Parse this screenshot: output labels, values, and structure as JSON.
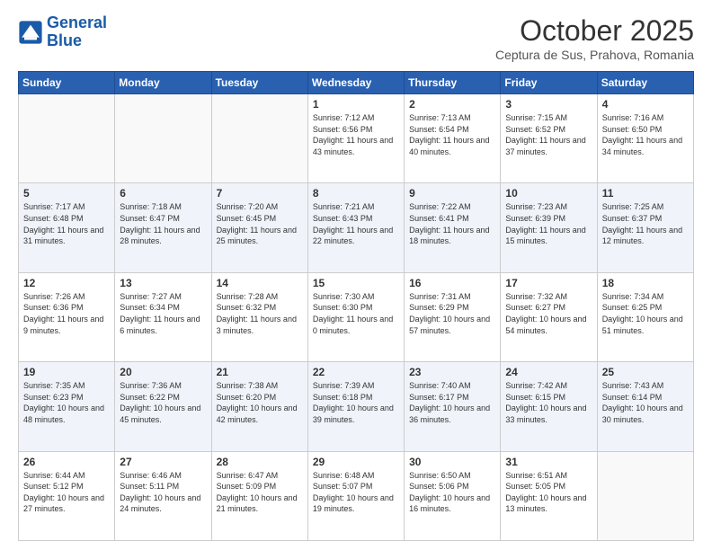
{
  "header": {
    "logo_line1": "General",
    "logo_line2": "Blue",
    "month": "October 2025",
    "location": "Ceptura de Sus, Prahova, Romania"
  },
  "weekdays": [
    "Sunday",
    "Monday",
    "Tuesday",
    "Wednesday",
    "Thursday",
    "Friday",
    "Saturday"
  ],
  "weeks": [
    [
      {
        "day": "",
        "info": ""
      },
      {
        "day": "",
        "info": ""
      },
      {
        "day": "",
        "info": ""
      },
      {
        "day": "1",
        "info": "Sunrise: 7:12 AM\nSunset: 6:56 PM\nDaylight: 11 hours and 43 minutes."
      },
      {
        "day": "2",
        "info": "Sunrise: 7:13 AM\nSunset: 6:54 PM\nDaylight: 11 hours and 40 minutes."
      },
      {
        "day": "3",
        "info": "Sunrise: 7:15 AM\nSunset: 6:52 PM\nDaylight: 11 hours and 37 minutes."
      },
      {
        "day": "4",
        "info": "Sunrise: 7:16 AM\nSunset: 6:50 PM\nDaylight: 11 hours and 34 minutes."
      }
    ],
    [
      {
        "day": "5",
        "info": "Sunrise: 7:17 AM\nSunset: 6:48 PM\nDaylight: 11 hours and 31 minutes."
      },
      {
        "day": "6",
        "info": "Sunrise: 7:18 AM\nSunset: 6:47 PM\nDaylight: 11 hours and 28 minutes."
      },
      {
        "day": "7",
        "info": "Sunrise: 7:20 AM\nSunset: 6:45 PM\nDaylight: 11 hours and 25 minutes."
      },
      {
        "day": "8",
        "info": "Sunrise: 7:21 AM\nSunset: 6:43 PM\nDaylight: 11 hours and 22 minutes."
      },
      {
        "day": "9",
        "info": "Sunrise: 7:22 AM\nSunset: 6:41 PM\nDaylight: 11 hours and 18 minutes."
      },
      {
        "day": "10",
        "info": "Sunrise: 7:23 AM\nSunset: 6:39 PM\nDaylight: 11 hours and 15 minutes."
      },
      {
        "day": "11",
        "info": "Sunrise: 7:25 AM\nSunset: 6:37 PM\nDaylight: 11 hours and 12 minutes."
      }
    ],
    [
      {
        "day": "12",
        "info": "Sunrise: 7:26 AM\nSunset: 6:36 PM\nDaylight: 11 hours and 9 minutes."
      },
      {
        "day": "13",
        "info": "Sunrise: 7:27 AM\nSunset: 6:34 PM\nDaylight: 11 hours and 6 minutes."
      },
      {
        "day": "14",
        "info": "Sunrise: 7:28 AM\nSunset: 6:32 PM\nDaylight: 11 hours and 3 minutes."
      },
      {
        "day": "15",
        "info": "Sunrise: 7:30 AM\nSunset: 6:30 PM\nDaylight: 11 hours and 0 minutes."
      },
      {
        "day": "16",
        "info": "Sunrise: 7:31 AM\nSunset: 6:29 PM\nDaylight: 10 hours and 57 minutes."
      },
      {
        "day": "17",
        "info": "Sunrise: 7:32 AM\nSunset: 6:27 PM\nDaylight: 10 hours and 54 minutes."
      },
      {
        "day": "18",
        "info": "Sunrise: 7:34 AM\nSunset: 6:25 PM\nDaylight: 10 hours and 51 minutes."
      }
    ],
    [
      {
        "day": "19",
        "info": "Sunrise: 7:35 AM\nSunset: 6:23 PM\nDaylight: 10 hours and 48 minutes."
      },
      {
        "day": "20",
        "info": "Sunrise: 7:36 AM\nSunset: 6:22 PM\nDaylight: 10 hours and 45 minutes."
      },
      {
        "day": "21",
        "info": "Sunrise: 7:38 AM\nSunset: 6:20 PM\nDaylight: 10 hours and 42 minutes."
      },
      {
        "day": "22",
        "info": "Sunrise: 7:39 AM\nSunset: 6:18 PM\nDaylight: 10 hours and 39 minutes."
      },
      {
        "day": "23",
        "info": "Sunrise: 7:40 AM\nSunset: 6:17 PM\nDaylight: 10 hours and 36 minutes."
      },
      {
        "day": "24",
        "info": "Sunrise: 7:42 AM\nSunset: 6:15 PM\nDaylight: 10 hours and 33 minutes."
      },
      {
        "day": "25",
        "info": "Sunrise: 7:43 AM\nSunset: 6:14 PM\nDaylight: 10 hours and 30 minutes."
      }
    ],
    [
      {
        "day": "26",
        "info": "Sunrise: 6:44 AM\nSunset: 5:12 PM\nDaylight: 10 hours and 27 minutes."
      },
      {
        "day": "27",
        "info": "Sunrise: 6:46 AM\nSunset: 5:11 PM\nDaylight: 10 hours and 24 minutes."
      },
      {
        "day": "28",
        "info": "Sunrise: 6:47 AM\nSunset: 5:09 PM\nDaylight: 10 hours and 21 minutes."
      },
      {
        "day": "29",
        "info": "Sunrise: 6:48 AM\nSunset: 5:07 PM\nDaylight: 10 hours and 19 minutes."
      },
      {
        "day": "30",
        "info": "Sunrise: 6:50 AM\nSunset: 5:06 PM\nDaylight: 10 hours and 16 minutes."
      },
      {
        "day": "31",
        "info": "Sunrise: 6:51 AM\nSunset: 5:05 PM\nDaylight: 10 hours and 13 minutes."
      },
      {
        "day": "",
        "info": ""
      }
    ]
  ]
}
